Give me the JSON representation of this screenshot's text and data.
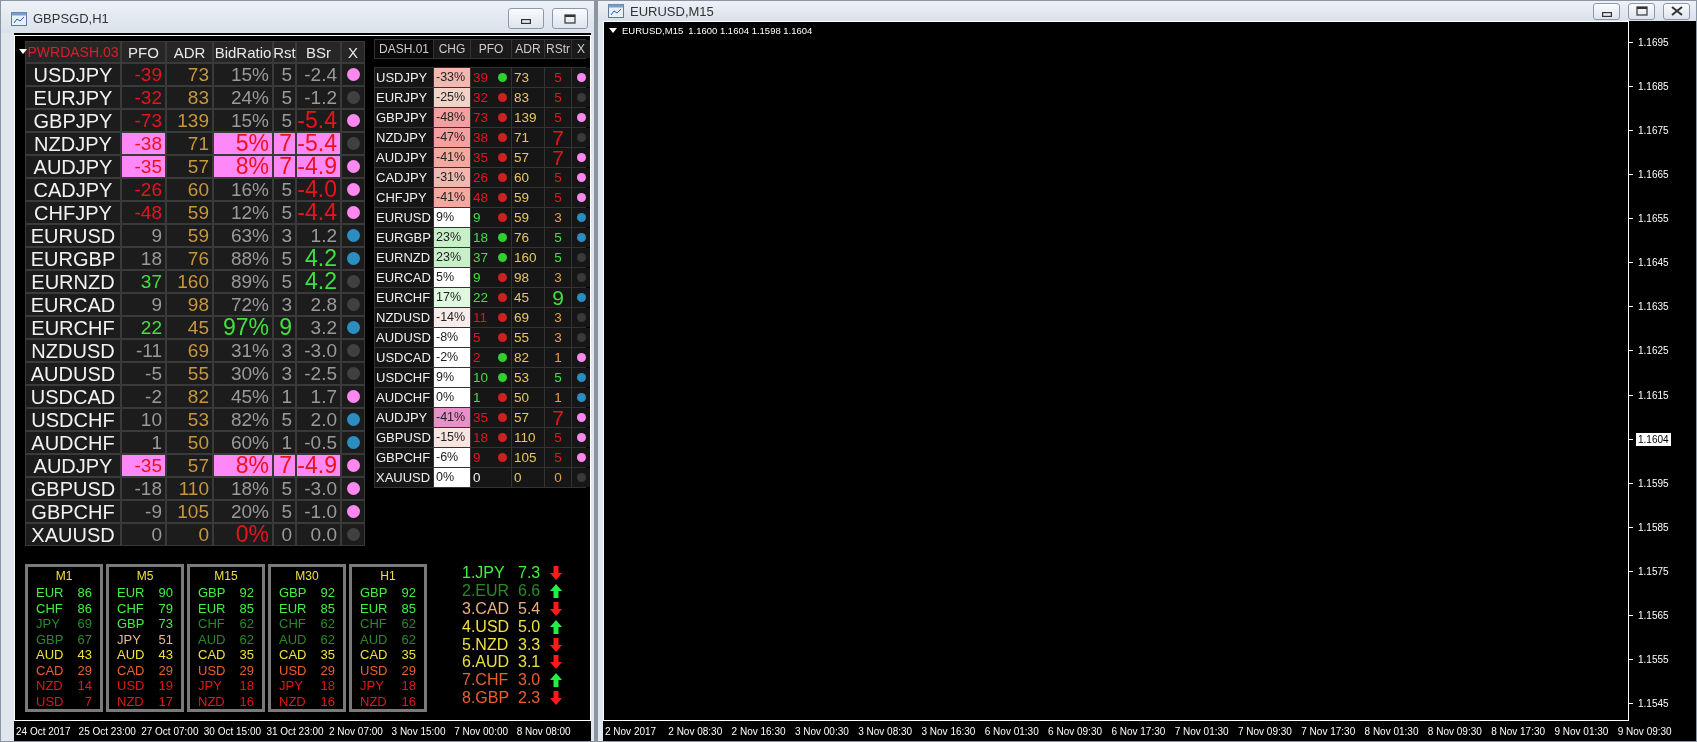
{
  "left_window": {
    "title": "GBPSGD,H1",
    "buttons": [
      {
        "kind": "minimize"
      },
      {
        "kind": "maximize"
      }
    ],
    "power_dashboard": {
      "columns": [
        "PWRDASH.03",
        "PFO",
        "ADR",
        "BidRatio",
        "Rst",
        "BSr",
        "X"
      ],
      "rows": [
        {
          "symbol": "USDJPY",
          "highlighted": false,
          "pfo": {
            "text": "-39",
            "kind": "red"
          },
          "adr": "73",
          "bid_ratio": {
            "text": "15%",
            "kind": "grey"
          },
          "rst": {
            "text": "5",
            "kind": "grey"
          },
          "bsr": {
            "text": "-2.4",
            "kind": "grey"
          },
          "status_dot": {
            "color": "#ff88f0"
          }
        },
        {
          "symbol": "EURJPY",
          "highlighted": false,
          "pfo": {
            "text": "-32",
            "kind": "red"
          },
          "adr": "83",
          "bid_ratio": {
            "text": "24%",
            "kind": "grey"
          },
          "rst": {
            "text": "5",
            "kind": "grey"
          },
          "bsr": {
            "text": "-1.2",
            "kind": "grey"
          },
          "status_dot": {
            "color": "#404040"
          }
        },
        {
          "symbol": "GBPJPY",
          "highlighted": false,
          "pfo": {
            "text": "-73",
            "kind": "red"
          },
          "adr": "139",
          "bid_ratio": {
            "text": "15%",
            "kind": "grey"
          },
          "rst": {
            "text": "5",
            "kind": "grey"
          },
          "bsr": {
            "text": "-5.4",
            "kind": "red-large"
          },
          "status_dot": {
            "color": "#ff88f0"
          }
        },
        {
          "symbol": "NZDJPY",
          "highlighted": true,
          "pfo": {
            "text": "-38",
            "kind": "red"
          },
          "adr": "71",
          "bid_ratio": {
            "text": "5%",
            "kind": "red-large"
          },
          "rst": {
            "text": "7",
            "kind": "red-large"
          },
          "bsr": {
            "text": "-5.4",
            "kind": "red-large"
          },
          "status_dot": {
            "color": "#404040"
          }
        },
        {
          "symbol": "AUDJPY",
          "highlighted": true,
          "pfo": {
            "text": "-35",
            "kind": "red"
          },
          "adr": "57",
          "bid_ratio": {
            "text": "8%",
            "kind": "red-large"
          },
          "rst": {
            "text": "7",
            "kind": "red-large"
          },
          "bsr": {
            "text": "-4.9",
            "kind": "red-large"
          },
          "status_dot": {
            "color": "#ff88f0"
          }
        },
        {
          "symbol": "CADJPY",
          "highlighted": false,
          "pfo": {
            "text": "-26",
            "kind": "red"
          },
          "adr": "60",
          "bid_ratio": {
            "text": "16%",
            "kind": "grey"
          },
          "rst": {
            "text": "5",
            "kind": "grey"
          },
          "bsr": {
            "text": "-4.0",
            "kind": "red-large"
          },
          "status_dot": {
            "color": "#ff88f0"
          }
        },
        {
          "symbol": "CHFJPY",
          "highlighted": false,
          "pfo": {
            "text": "-48",
            "kind": "red"
          },
          "adr": "59",
          "bid_ratio": {
            "text": "12%",
            "kind": "grey"
          },
          "rst": {
            "text": "5",
            "kind": "grey"
          },
          "bsr": {
            "text": "-4.4",
            "kind": "red-large"
          },
          "status_dot": {
            "color": "#ff88f0"
          }
        },
        {
          "symbol": "EURUSD",
          "highlighted": false,
          "pfo": {
            "text": "9",
            "kind": "grey"
          },
          "adr": "59",
          "bid_ratio": {
            "text": "63%",
            "kind": "grey"
          },
          "rst": {
            "text": "3",
            "kind": "grey"
          },
          "bsr": {
            "text": "1.2",
            "kind": "grey"
          },
          "status_dot": {
            "color": "#2a8fc0"
          }
        },
        {
          "symbol": "EURGBP",
          "highlighted": false,
          "pfo": {
            "text": "18",
            "kind": "grey"
          },
          "adr": "76",
          "bid_ratio": {
            "text": "88%",
            "kind": "grey"
          },
          "rst": {
            "text": "5",
            "kind": "grey"
          },
          "bsr": {
            "text": "4.2",
            "kind": "green-large"
          },
          "status_dot": {
            "color": "#2a8fc0"
          }
        },
        {
          "symbol": "EURNZD",
          "highlighted": false,
          "pfo": {
            "text": "37",
            "kind": "green"
          },
          "adr": "160",
          "bid_ratio": {
            "text": "89%",
            "kind": "grey"
          },
          "rst": {
            "text": "5",
            "kind": "grey"
          },
          "bsr": {
            "text": "4.2",
            "kind": "green-large"
          },
          "status_dot": {
            "color": "#404040"
          }
        },
        {
          "symbol": "EURCAD",
          "highlighted": false,
          "pfo": {
            "text": "9",
            "kind": "grey"
          },
          "adr": "98",
          "bid_ratio": {
            "text": "72%",
            "kind": "grey"
          },
          "rst": {
            "text": "3",
            "kind": "grey"
          },
          "bsr": {
            "text": "2.8",
            "kind": "grey"
          },
          "status_dot": {
            "color": "#404040"
          }
        },
        {
          "symbol": "EURCHF",
          "highlighted": false,
          "pfo": {
            "text": "22",
            "kind": "green"
          },
          "adr": "45",
          "bid_ratio": {
            "text": "97%",
            "kind": "green-large"
          },
          "rst": {
            "text": "9",
            "kind": "green-large"
          },
          "bsr": {
            "text": "3.2",
            "kind": "grey"
          },
          "status_dot": {
            "color": "#2a8fc0"
          }
        },
        {
          "symbol": "NZDUSD",
          "highlighted": false,
          "pfo": {
            "text": "-11",
            "kind": "grey"
          },
          "adr": "69",
          "bid_ratio": {
            "text": "31%",
            "kind": "grey"
          },
          "rst": {
            "text": "3",
            "kind": "grey"
          },
          "bsr": {
            "text": "-3.0",
            "kind": "grey"
          },
          "status_dot": {
            "color": "#404040"
          }
        },
        {
          "symbol": "AUDUSD",
          "highlighted": false,
          "pfo": {
            "text": "-5",
            "kind": "grey"
          },
          "adr": "55",
          "bid_ratio": {
            "text": "30%",
            "kind": "grey"
          },
          "rst": {
            "text": "3",
            "kind": "grey"
          },
          "bsr": {
            "text": "-2.5",
            "kind": "grey"
          },
          "status_dot": {
            "color": "#404040"
          }
        },
        {
          "symbol": "USDCAD",
          "highlighted": false,
          "pfo": {
            "text": "-2",
            "kind": "grey"
          },
          "adr": "82",
          "bid_ratio": {
            "text": "45%",
            "kind": "grey"
          },
          "rst": {
            "text": "1",
            "kind": "grey"
          },
          "bsr": {
            "text": "1.7",
            "kind": "grey"
          },
          "status_dot": {
            "color": "#ff88f0"
          }
        },
        {
          "symbol": "USDCHF",
          "highlighted": false,
          "pfo": {
            "text": "10",
            "kind": "grey"
          },
          "adr": "53",
          "bid_ratio": {
            "text": "82%",
            "kind": "grey"
          },
          "rst": {
            "text": "5",
            "kind": "grey"
          },
          "bsr": {
            "text": "2.0",
            "kind": "grey"
          },
          "status_dot": {
            "color": "#2a8fc0"
          }
        },
        {
          "symbol": "AUDCHF",
          "highlighted": false,
          "pfo": {
            "text": "1",
            "kind": "grey"
          },
          "adr": "50",
          "bid_ratio": {
            "text": "60%",
            "kind": "grey"
          },
          "rst": {
            "text": "1",
            "kind": "grey"
          },
          "bsr": {
            "text": "-0.5",
            "kind": "grey"
          },
          "status_dot": {
            "color": "#2a8fc0"
          }
        },
        {
          "symbol": "AUDJPY",
          "highlighted": true,
          "pfo": {
            "text": "-35",
            "kind": "red"
          },
          "adr": "57",
          "bid_ratio": {
            "text": "8%",
            "kind": "red-large"
          },
          "rst": {
            "text": "7",
            "kind": "red-large"
          },
          "bsr": {
            "text": "-4.9",
            "kind": "red-large"
          },
          "status_dot": {
            "color": "#ff88f0"
          }
        },
        {
          "symbol": "GBPUSD",
          "highlighted": false,
          "pfo": {
            "text": "-18",
            "kind": "grey"
          },
          "adr": "110",
          "bid_ratio": {
            "text": "18%",
            "kind": "grey"
          },
          "rst": {
            "text": "5",
            "kind": "grey"
          },
          "bsr": {
            "text": "-3.0",
            "kind": "grey"
          },
          "status_dot": {
            "color": "#ff88f0"
          }
        },
        {
          "symbol": "GBPCHF",
          "highlighted": false,
          "pfo": {
            "text": "-9",
            "kind": "grey"
          },
          "adr": "105",
          "bid_ratio": {
            "text": "20%",
            "kind": "grey"
          },
          "rst": {
            "text": "5",
            "kind": "grey"
          },
          "bsr": {
            "text": "-1.0",
            "kind": "grey"
          },
          "status_dot": {
            "color": "#ff88f0"
          }
        },
        {
          "symbol": "XAUUSD",
          "highlighted": false,
          "pfo": {
            "text": "0",
            "kind": "grey"
          },
          "adr": "0",
          "bid_ratio": {
            "text": "0%",
            "kind": "red-large"
          },
          "rst": {
            "text": "0",
            "kind": "grey"
          },
          "bsr": {
            "text": "0.0",
            "kind": "grey"
          },
          "status_dot": {
            "color": "#404040"
          }
        }
      ]
    },
    "dash_table": {
      "columns": [
        "DASH.01",
        "CHG",
        "PFO",
        "ADR",
        "RStr",
        "X"
      ],
      "rows": [
        {
          "symbol": "USDJPY",
          "chg": {
            "text": "-33%",
            "color": "#f4b8b0"
          },
          "pfo": {
            "text": "39",
            "kind": "red",
            "dot": {
              "color": "#30d030"
            }
          },
          "adr": "73",
          "rstr": {
            "text": "5",
            "kind": "red"
          },
          "status_dot": {
            "color": "#ff88f0"
          }
        },
        {
          "symbol": "EURJPY",
          "chg": {
            "text": "-25%",
            "color": "#f0d4c8"
          },
          "pfo": {
            "text": "32",
            "kind": "red",
            "dot": {
              "color": "#d02020"
            }
          },
          "adr": "83",
          "rstr": {
            "text": "5",
            "kind": "red"
          },
          "status_dot": {
            "color": "#3a3a3a"
          }
        },
        {
          "symbol": "GBPJPY",
          "chg": {
            "text": "-48%",
            "color": "#f4a0a0"
          },
          "pfo": {
            "text": "73",
            "kind": "red",
            "dot": {
              "color": "#d02020"
            }
          },
          "adr": "139",
          "rstr": {
            "text": "5",
            "kind": "red"
          },
          "status_dot": {
            "color": "#ff88f0"
          }
        },
        {
          "symbol": "NZDJPY",
          "chg": {
            "text": "-47%",
            "color": "#f4a0a0"
          },
          "pfo": {
            "text": "38",
            "kind": "red",
            "dot": {
              "color": "#d02020"
            }
          },
          "adr": "71",
          "rstr": {
            "text": "7",
            "kind": "red-large"
          },
          "status_dot": {
            "color": "#3a3a3a"
          }
        },
        {
          "symbol": "AUDJPY",
          "chg": {
            "text": "-41%",
            "color": "#f4a8a0"
          },
          "pfo": {
            "text": "35",
            "kind": "red",
            "dot": {
              "color": "#d02020"
            }
          },
          "adr": "57",
          "rstr": {
            "text": "7",
            "kind": "red-large"
          },
          "status_dot": {
            "color": "#ff88f0"
          }
        },
        {
          "symbol": "CADJPY",
          "chg": {
            "text": "-31%",
            "color": "#f0b8b0"
          },
          "pfo": {
            "text": "26",
            "kind": "red",
            "dot": {
              "color": "#d02020"
            }
          },
          "adr": "60",
          "rstr": {
            "text": "5",
            "kind": "red"
          },
          "status_dot": {
            "color": "#ff88f0"
          }
        },
        {
          "symbol": "CHFJPY",
          "chg": {
            "text": "-41%",
            "color": "#f4a8a0"
          },
          "pfo": {
            "text": "48",
            "kind": "red",
            "dot": {
              "color": "#d02020"
            }
          },
          "adr": "59",
          "rstr": {
            "text": "5",
            "kind": "red"
          },
          "status_dot": {
            "color": "#ff88f0"
          }
        },
        {
          "symbol": "EURUSD",
          "chg": {
            "text": "9%",
            "color": "#ffffff"
          },
          "pfo": {
            "text": "9",
            "kind": "green",
            "dot": {
              "color": "#d02020"
            }
          },
          "adr": "59",
          "rstr": {
            "text": "3",
            "kind": "orange"
          },
          "status_dot": {
            "color": "#2a8fc0"
          }
        },
        {
          "symbol": "EURGBP",
          "chg": {
            "text": "23%",
            "color": "#c8f0c8"
          },
          "pfo": {
            "text": "18",
            "kind": "green",
            "dot": {
              "color": "#30d030"
            }
          },
          "adr": "76",
          "rstr": {
            "text": "5",
            "kind": "green"
          },
          "status_dot": {
            "color": "#2a8fc0"
          }
        },
        {
          "symbol": "EURNZD",
          "chg": {
            "text": "23%",
            "color": "#c8f0c8"
          },
          "pfo": {
            "text": "37",
            "kind": "green",
            "dot": {
              "color": "#30d030"
            }
          },
          "adr": "160",
          "rstr": {
            "text": "5",
            "kind": "green"
          },
          "status_dot": {
            "color": "#3a3a3a"
          }
        },
        {
          "symbol": "EURCAD",
          "chg": {
            "text": "5%",
            "color": "#ffffff"
          },
          "pfo": {
            "text": "9",
            "kind": "green",
            "dot": {
              "color": "#d02020"
            }
          },
          "adr": "98",
          "rstr": {
            "text": "3",
            "kind": "orange"
          },
          "status_dot": {
            "color": "#3a3a3a"
          }
        },
        {
          "symbol": "EURCHF",
          "chg": {
            "text": "17%",
            "color": "#e0f8e0"
          },
          "pfo": {
            "text": "22",
            "kind": "green",
            "dot": {
              "color": "#d02020"
            }
          },
          "adr": "45",
          "rstr": {
            "text": "9",
            "kind": "green-large"
          },
          "status_dot": {
            "color": "#2a8fc0"
          }
        },
        {
          "symbol": "NZDUSD",
          "chg": {
            "text": "-14%",
            "color": "#f8ecea"
          },
          "pfo": {
            "text": "11",
            "kind": "red",
            "dot": {
              "color": "#d02020"
            }
          },
          "adr": "69",
          "rstr": {
            "text": "3",
            "kind": "orange"
          },
          "status_dot": {
            "color": "#3a3a3a"
          }
        },
        {
          "symbol": "AUDUSD",
          "chg": {
            "text": "-8%",
            "color": "#ffffff"
          },
          "pfo": {
            "text": "5",
            "kind": "red",
            "dot": {
              "color": "#d02020"
            }
          },
          "adr": "55",
          "rstr": {
            "text": "3",
            "kind": "orange"
          },
          "status_dot": {
            "color": "#3a3a3a"
          }
        },
        {
          "symbol": "USDCAD",
          "chg": {
            "text": "-2%",
            "color": "#ffffff"
          },
          "pfo": {
            "text": "2",
            "kind": "red",
            "dot": {
              "color": "#30d030"
            }
          },
          "adr": "82",
          "rstr": {
            "text": "1",
            "kind": "orange"
          },
          "status_dot": {
            "color": "#ff88f0"
          }
        },
        {
          "symbol": "USDCHF",
          "chg": {
            "text": "9%",
            "color": "#ffffff"
          },
          "pfo": {
            "text": "10",
            "kind": "green",
            "dot": {
              "color": "#30d030"
            }
          },
          "adr": "53",
          "rstr": {
            "text": "5",
            "kind": "green"
          },
          "status_dot": {
            "color": "#2a8fc0"
          }
        },
        {
          "symbol": "AUDCHF",
          "chg": {
            "text": "0%",
            "color": "#ffffff"
          },
          "pfo": {
            "text": "1",
            "kind": "green",
            "dot": {
              "color": "#d02020"
            }
          },
          "adr": "50",
          "rstr": {
            "text": "1",
            "kind": "orange"
          },
          "status_dot": {
            "color": "#2a8fc0"
          }
        },
        {
          "symbol": "AUDJPY",
          "chg": {
            "text": "-41%",
            "color": "#e890c8"
          },
          "pfo": {
            "text": "35",
            "kind": "red",
            "dot": {
              "color": "#d02020"
            }
          },
          "adr": "57",
          "rstr": {
            "text": "7",
            "kind": "red-large"
          },
          "status_dot": {
            "color": "#ff88f0"
          }
        },
        {
          "symbol": "GBPUSD",
          "chg": {
            "text": "-15%",
            "color": "#f8e4e0"
          },
          "pfo": {
            "text": "18",
            "kind": "red",
            "dot": {
              "color": "#d02020"
            }
          },
          "adr": "110",
          "rstr": {
            "text": "5",
            "kind": "red"
          },
          "status_dot": {
            "color": "#ff88f0"
          }
        },
        {
          "symbol": "GBPCHF",
          "chg": {
            "text": "-6%",
            "color": "#ffffff"
          },
          "pfo": {
            "text": "9",
            "kind": "red",
            "dot": {
              "color": "#d02020"
            }
          },
          "adr": "105",
          "rstr": {
            "text": "5",
            "kind": "red"
          },
          "status_dot": {
            "color": "#ff88f0"
          }
        },
        {
          "symbol": "XAUUSD",
          "chg": {
            "text": "0%",
            "color": "#ffffff"
          },
          "pfo": {
            "text": "0",
            "kind": "white"
          },
          "adr": "0",
          "rstr": {
            "text": "0",
            "kind": "orange"
          },
          "status_dot": {
            "color": "#3a3a3a"
          }
        }
      ]
    },
    "timeframes": [
      {
        "title": "M1",
        "entries": [
          {
            "currency": "EUR",
            "value": "86",
            "color": "#44ee44"
          },
          {
            "currency": "CHF",
            "value": "86",
            "color": "#44ee44"
          },
          {
            "currency": "JPY",
            "value": "69",
            "color": "#2a8a2a"
          },
          {
            "currency": "GBP",
            "value": "67",
            "color": "#2a8a2a"
          },
          {
            "currency": "AUD",
            "value": "43",
            "color": "#f0e040"
          },
          {
            "currency": "CAD",
            "value": "29",
            "color": "#e86030"
          },
          {
            "currency": "NZD",
            "value": "14",
            "color": "#e01818"
          },
          {
            "currency": "USD",
            "value": "7",
            "color": "#e01818"
          }
        ]
      },
      {
        "title": "M5",
        "entries": [
          {
            "currency": "EUR",
            "value": "90",
            "color": "#44ee44"
          },
          {
            "currency": "CHF",
            "value": "79",
            "color": "#44ee44"
          },
          {
            "currency": "GBP",
            "value": "73",
            "color": "#44ee44"
          },
          {
            "currency": "JPY",
            "value": "51",
            "color": "#e8b890"
          },
          {
            "currency": "AUD",
            "value": "43",
            "color": "#f0e040"
          },
          {
            "currency": "CAD",
            "value": "29",
            "color": "#e86030"
          },
          {
            "currency": "USD",
            "value": "19",
            "color": "#e01818"
          },
          {
            "currency": "NZD",
            "value": "17",
            "color": "#e01818"
          }
        ]
      },
      {
        "title": "M15",
        "entries": [
          {
            "currency": "GBP",
            "value": "92",
            "color": "#44ee44"
          },
          {
            "currency": "EUR",
            "value": "85",
            "color": "#44ee44"
          },
          {
            "currency": "CHF",
            "value": "62",
            "color": "#2a8a2a"
          },
          {
            "currency": "AUD",
            "value": "62",
            "color": "#2a8a2a"
          },
          {
            "currency": "CAD",
            "value": "35",
            "color": "#f0e040"
          },
          {
            "currency": "USD",
            "value": "29",
            "color": "#e86030"
          },
          {
            "currency": "JPY",
            "value": "18",
            "color": "#e01818"
          },
          {
            "currency": "NZD",
            "value": "16",
            "color": "#e01818"
          }
        ]
      },
      {
        "title": "M30",
        "entries": [
          {
            "currency": "GBP",
            "value": "92",
            "color": "#44ee44"
          },
          {
            "currency": "EUR",
            "value": "85",
            "color": "#44ee44"
          },
          {
            "currency": "CHF",
            "value": "62",
            "color": "#2a8a2a"
          },
          {
            "currency": "AUD",
            "value": "62",
            "color": "#2a8a2a"
          },
          {
            "currency": "CAD",
            "value": "35",
            "color": "#f0e040"
          },
          {
            "currency": "USD",
            "value": "29",
            "color": "#e86030"
          },
          {
            "currency": "JPY",
            "value": "18",
            "color": "#e01818"
          },
          {
            "currency": "NZD",
            "value": "16",
            "color": "#e01818"
          }
        ]
      },
      {
        "title": "H1",
        "entries": [
          {
            "currency": "GBP",
            "value": "92",
            "color": "#44ee44"
          },
          {
            "currency": "EUR",
            "value": "85",
            "color": "#44ee44"
          },
          {
            "currency": "CHF",
            "value": "62",
            "color": "#2a8a2a"
          },
          {
            "currency": "AUD",
            "value": "62",
            "color": "#2a8a2a"
          },
          {
            "currency": "CAD",
            "value": "35",
            "color": "#f0e040"
          },
          {
            "currency": "USD",
            "value": "29",
            "color": "#e86030"
          },
          {
            "currency": "JPY",
            "value": "18",
            "color": "#e01818"
          },
          {
            "currency": "NZD",
            "value": "16",
            "color": "#e01818"
          }
        ]
      }
    ],
    "strength_ranking": [
      {
        "label": "1.JPY",
        "value": "7.3",
        "color": "#44ee44",
        "kind": "down"
      },
      {
        "label": "2.EUR",
        "value": "6.6",
        "color": "#2a8a2a",
        "kind": "up"
      },
      {
        "label": "3.CAD",
        "value": "5.4",
        "color": "#e8b080",
        "kind": "down"
      },
      {
        "label": "4.USD",
        "value": "5.0",
        "color": "#f0e040",
        "kind": "up"
      },
      {
        "label": "5.NZD",
        "value": "3.3",
        "color": "#f0e040",
        "kind": "down"
      },
      {
        "label": "6.AUD",
        "value": "3.1",
        "color": "#e8e040",
        "kind": "down"
      },
      {
        "label": "7.CHF",
        "value": "3.0",
        "color": "#e86030",
        "kind": "up"
      },
      {
        "label": "8.GBP",
        "value": "2.3",
        "color": "#e86030",
        "kind": "down"
      }
    ],
    "time_axis": [
      "24 Oct 2017",
      "25 Oct 23:00",
      "27 Oct 07:00",
      "30 Oct 15:00",
      "31 Oct 23:00",
      "2 Nov 07:00",
      "3 Nov 15:00",
      "7 Nov 00:00",
      "8 Nov 08:00"
    ]
  },
  "right_window": {
    "title": "EURUSD,M15",
    "buttons": [
      {
        "kind": "minimize"
      },
      {
        "kind": "maximize"
      },
      {
        "kind": "close"
      }
    ],
    "chart_header": {
      "symbol": "EURUSD,M15",
      "prices": "1.1600 1.1604 1.1598 1.1604"
    },
    "price_axis": [
      {
        "text": "1.1695",
        "current": false
      },
      {
        "text": "1.1685",
        "current": false
      },
      {
        "text": "1.1675",
        "current": false
      },
      {
        "text": "1.1665",
        "current": false
      },
      {
        "text": "1.1655",
        "current": false
      },
      {
        "text": "1.1645",
        "current": false
      },
      {
        "text": "1.1635",
        "current": false
      },
      {
        "text": "1.1625",
        "current": false
      },
      {
        "text": "1.1615",
        "current": false
      },
      {
        "text": "1.1604",
        "current": true
      },
      {
        "text": "1.1595",
        "current": false
      },
      {
        "text": "1.1585",
        "current": false
      },
      {
        "text": "1.1575",
        "current": false
      },
      {
        "text": "1.1565",
        "current": false
      },
      {
        "text": "1.1555",
        "current": false
      },
      {
        "text": "1.1545",
        "current": false
      }
    ],
    "time_axis": [
      "2 Nov 2017",
      "2 Nov 08:30",
      "2 Nov 16:30",
      "3 Nov 00:30",
      "3 Nov 08:30",
      "3 Nov 16:30",
      "6 Nov 01:30",
      "6 Nov 09:30",
      "6 Nov 17:30",
      "7 Nov 01:30",
      "7 Nov 09:30",
      "7 Nov 17:30",
      "8 Nov 01:30",
      "8 Nov 09:30",
      "8 Nov 17:30",
      "9 Nov 01:30",
      "9 Nov 09:30"
    ]
  }
}
